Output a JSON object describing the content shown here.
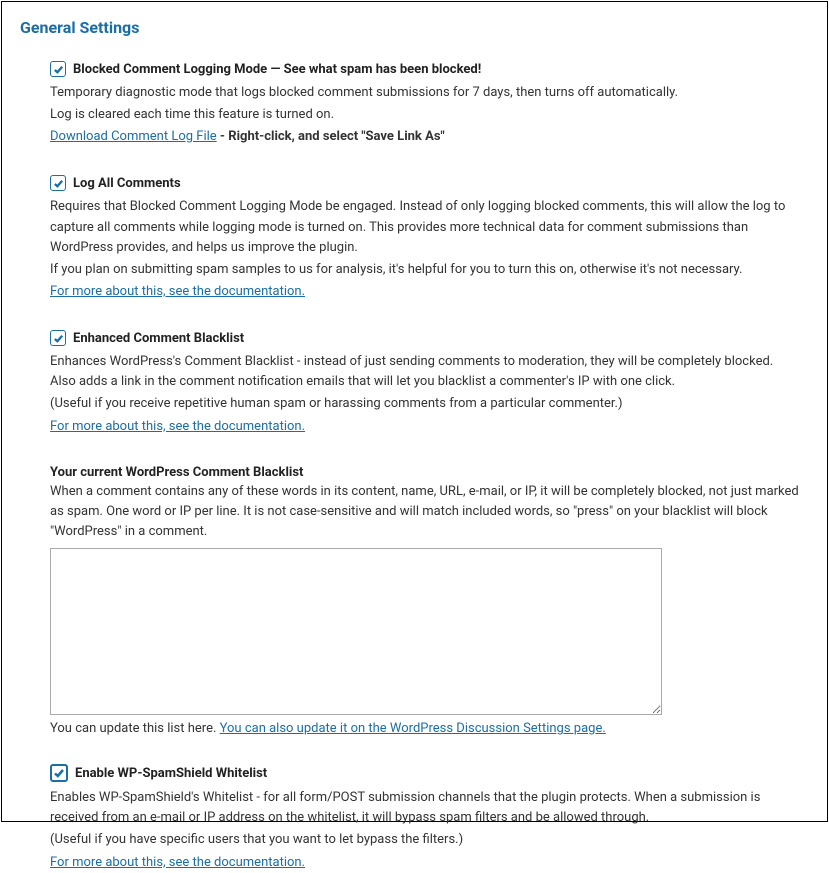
{
  "title": "General Settings",
  "settings": {
    "logging_mode": {
      "label": "Blocked Comment Logging Mode — See what spam has been blocked!",
      "desc1": "Temporary diagnostic mode that logs blocked comment submissions for 7 days, then turns off automatically.",
      "desc2": "Log is cleared each time this feature is turned on.",
      "download_link": "Download Comment Log File",
      "download_suffix": " - Right-click, and select \"Save Link As\""
    },
    "log_all": {
      "label": "Log All Comments",
      "desc1": "Requires that Blocked Comment Logging Mode be engaged. Instead of only logging blocked comments, this will allow the log to capture all comments while logging mode is turned on. This provides more technical data for comment submissions than WordPress provides, and helps us improve the plugin.",
      "desc2": "If you plan on submitting spam samples to us for analysis, it's helpful for you to turn this on, otherwise it's not necessary.",
      "doc_link": "For more about this, see the documentation."
    },
    "enhanced_blacklist": {
      "label": "Enhanced Comment Blacklist",
      "desc1": "Enhances WordPress's Comment Blacklist - instead of just sending comments to moderation, they will be completely blocked. Also adds a link in the comment notification emails that will let you blacklist a commenter's IP with one click.",
      "note": "(Useful if you receive repetitive human spam or harassing comments from a particular commenter.)",
      "doc_link": "For more about this, see the documentation."
    },
    "blacklist_textarea": {
      "heading": "Your current WordPress Comment Blacklist",
      "desc": "When a comment contains any of these words in its content, name, URL, e-mail, or IP, it will be completely blocked, not just marked as spam. One word or IP per line. It is not case-sensitive and will match included words, so \"press\" on your blacklist will block \"WordPress\" in a comment.",
      "value": "",
      "after_text": "You can update this list here. ",
      "after_link": "You can also update it on the WordPress Discussion Settings page."
    },
    "whitelist": {
      "label": "Enable WP-SpamShield Whitelist",
      "desc1": "Enables WP-SpamShield's Whitelist - for all form/POST submission channels that the plugin protects. When a submission is received from an e-mail or IP address on the whitelist, it will bypass spam filters and be allowed through.",
      "note": "(Useful if you have specific users that you want to let bypass the filters.)",
      "doc_link": "For more about this, see the documentation."
    }
  }
}
